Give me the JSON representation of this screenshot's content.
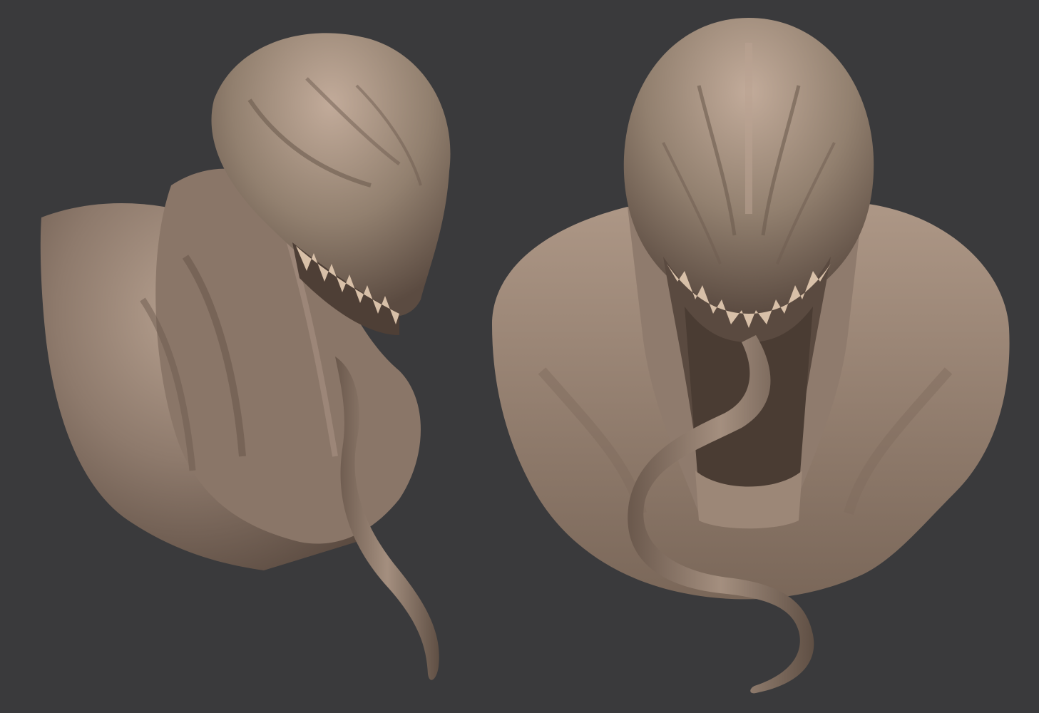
{
  "scene": {
    "background_color": "#3a3a3c",
    "material_color": "#8e7a6c",
    "material_highlight": "#c2ab9a",
    "material_shadow": "#4f4037",
    "teeth_color": "#d8c0a8",
    "views": [
      {
        "name": "three-quarter-view",
        "subject": "creature-bust-sculpt"
      },
      {
        "name": "front-view",
        "subject": "creature-bust-sculpt"
      }
    ]
  }
}
